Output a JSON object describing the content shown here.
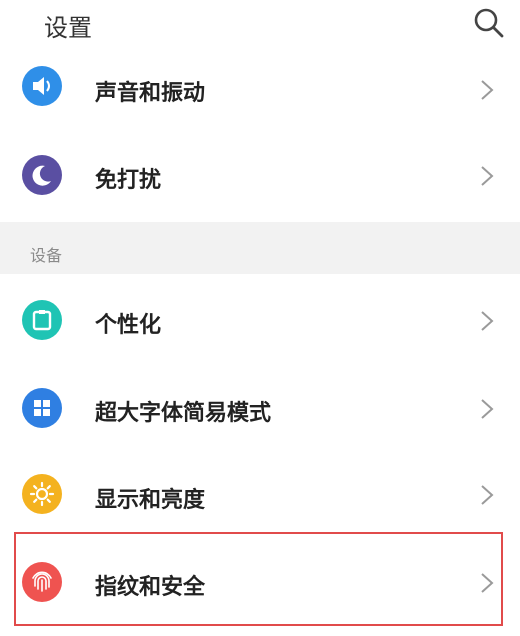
{
  "header": {
    "title": "设置",
    "search_icon": "search-icon"
  },
  "section_device": {
    "title": "设备"
  },
  "items": [
    {
      "label": "声音和振动",
      "icon": "sound-icon",
      "color": "#2f8fe8"
    },
    {
      "label": "免打扰",
      "icon": "moon-icon",
      "color": "#5a4fa2"
    },
    {
      "label": "个性化",
      "icon": "theme-icon",
      "color": "#1fc4b4"
    },
    {
      "label": "超大字体简易模式",
      "icon": "grid-icon",
      "color": "#2f7fe2"
    },
    {
      "label": "显示和亮度",
      "icon": "brightness-icon",
      "color": "#f4b21f"
    },
    {
      "label": "指纹和安全",
      "icon": "fingerprint-icon",
      "color": "#ef5350"
    }
  ],
  "colors": {
    "highlight": "#e14b4b",
    "section_bg": "#f2f2f2",
    "chevron": "#9a9a9a"
  }
}
